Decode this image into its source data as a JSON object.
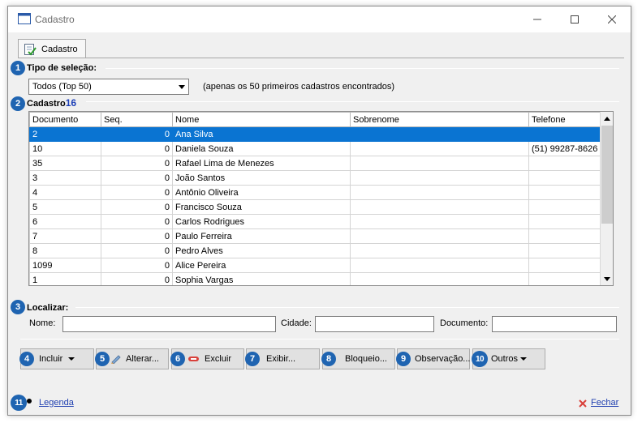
{
  "window": {
    "title": "Cadastro"
  },
  "tab": {
    "label": "Cadastro"
  },
  "selection": {
    "number": "1",
    "title": "Tipo de seleção:",
    "combo_value": "Todos (Top 50)",
    "note": "(apenas os 50 primeiros cadastros encontrados)"
  },
  "records": {
    "number": "2",
    "title": "Cadastro",
    "count": "16",
    "count_color": "#1c3fb7",
    "columns": [
      "Documento",
      "Seq.",
      "Nome",
      "Sobrenome",
      "Telefone"
    ],
    "rows": [
      [
        "2",
        "0",
        "Ana Silva",
        "",
        ""
      ],
      [
        "10",
        "0",
        "Daniela Souza",
        "",
        "(51) 99287-8626"
      ],
      [
        "35",
        "0",
        "Rafael Lima de Menezes",
        "",
        ""
      ],
      [
        "3",
        "0",
        "João Santos",
        "",
        ""
      ],
      [
        "4",
        "0",
        "Antônio Oliveira",
        "",
        ""
      ],
      [
        "5",
        "0",
        "Francisco Souza",
        "",
        ""
      ],
      [
        "6",
        "0",
        "Carlos Rodrigues",
        "",
        ""
      ],
      [
        "7",
        "0",
        "Paulo Ferreira",
        "",
        ""
      ],
      [
        "8",
        "0",
        "Pedro Alves",
        "",
        ""
      ],
      [
        "1099",
        "0",
        "Alice Pereira",
        "",
        ""
      ],
      [
        "1",
        "0",
        "Sophia Vargas",
        "",
        ""
      ]
    ],
    "selected_row": 0
  },
  "search": {
    "number": "3",
    "title": "Localizar:",
    "name_label": "Nome:",
    "city_label": "Cidade:",
    "document_label": "Documento:",
    "name_value": "",
    "city_value": "",
    "document_value": ""
  },
  "actions": {
    "include": {
      "number": "4",
      "label": "Incluir"
    },
    "alter": {
      "number": "5",
      "label": "Alterar..."
    },
    "delete": {
      "number": "6",
      "label": "Excluir"
    },
    "show": {
      "number": "7",
      "label": "Exibir..."
    },
    "block": {
      "number": "8",
      "label": "Bloqueio..."
    },
    "observation": {
      "number": "9",
      "label": "Observação..."
    },
    "others": {
      "number": "10",
      "label": "Outros"
    }
  },
  "footer": {
    "number": "11",
    "legend_label": "Legenda",
    "close_label": "Fechar"
  },
  "colors": {
    "accent": "#1f64b1",
    "selection": "#0a74d2",
    "link": "#1f3fb0",
    "close_icon": "#d9403a",
    "delete_icon": "#d9403a"
  },
  "icons": {
    "window": "window-icon",
    "tab": "checklist-icon",
    "alter": "pencil-icon",
    "delete": "minus-icon",
    "close": "x-icon"
  }
}
